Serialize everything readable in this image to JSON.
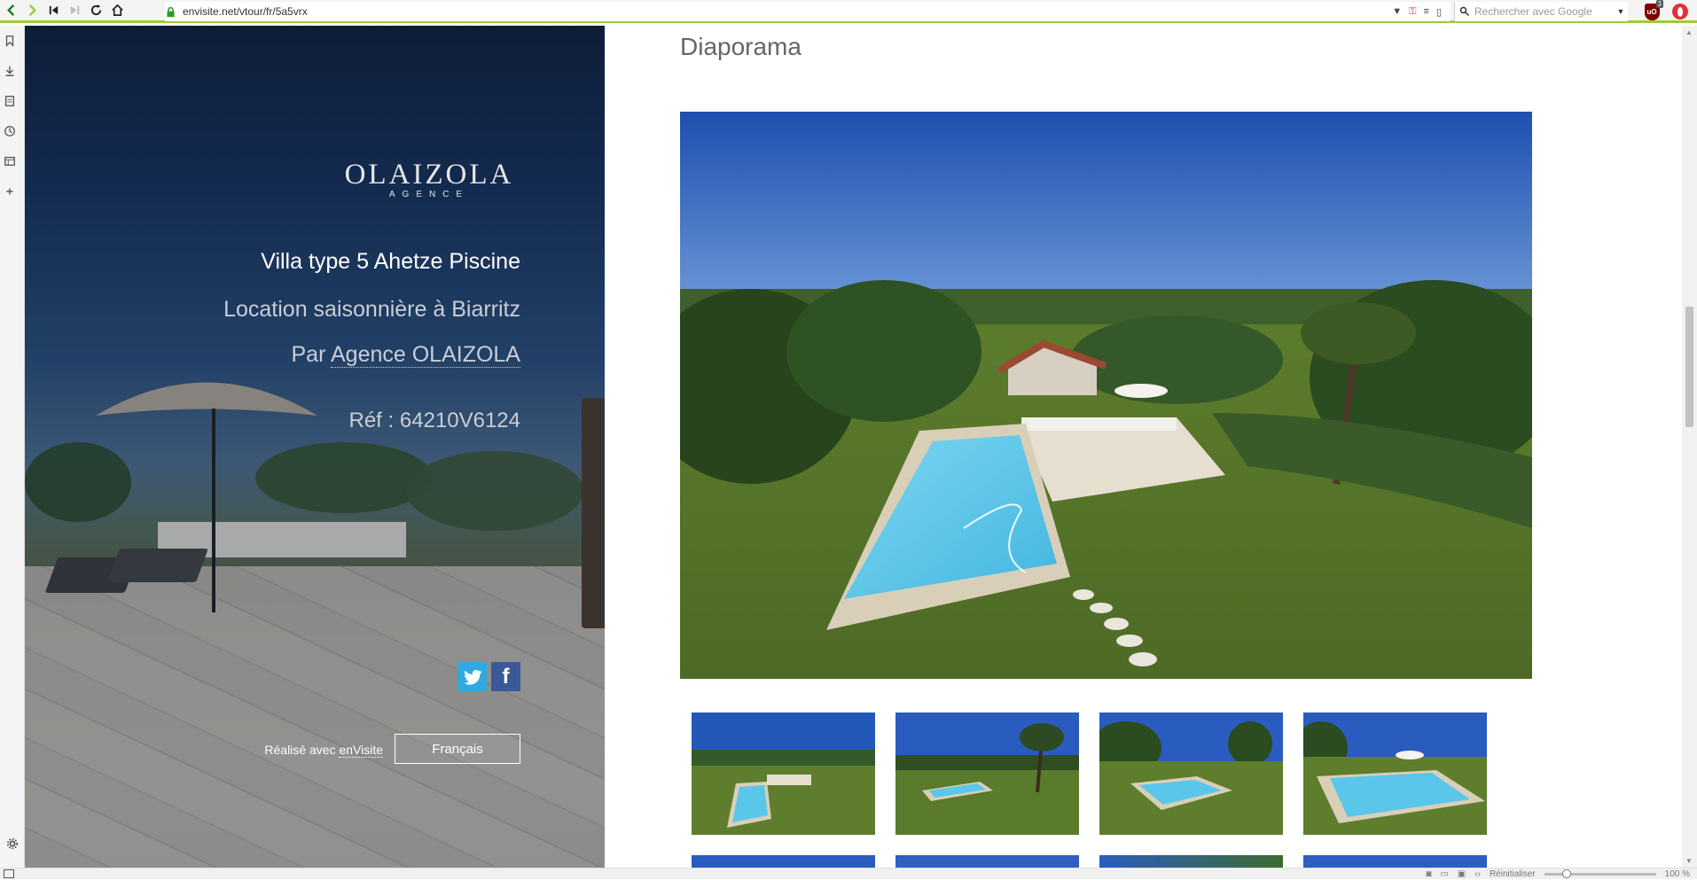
{
  "browser": {
    "url": "envisite.net/vtour/fr/5a5vrx",
    "search_placeholder": "Rechercher avec Google",
    "ublock_count": "3",
    "status_reset": "Réinitialiser",
    "zoom": "100 %"
  },
  "hero": {
    "brand_main": "OLAIZOLA",
    "brand_sub": "AGENCE",
    "title": "Villa type 5 Ahetze Piscine",
    "subtitle": "Location saisonnière à Biarritz",
    "agency_prefix": "Par",
    "agency_link": "Agence OLAIZOLA",
    "ref": "Réf : 64210V6124",
    "made_with_prefix": "Réalisé avec",
    "made_with_link": "enVisite",
    "language_button": "Français"
  },
  "gallery": {
    "title": "Diaporama"
  },
  "colors": {
    "toolbar_accent": "#9acd32",
    "twitter": "#2fa9e0",
    "facebook": "#3b5998"
  },
  "icons": [
    "back-icon",
    "forward-icon",
    "rewind-icon",
    "fast-forward-icon",
    "reload-icon",
    "home-icon",
    "lock-icon",
    "search-icon",
    "twitter-icon",
    "facebook-icon",
    "gear-icon"
  ]
}
